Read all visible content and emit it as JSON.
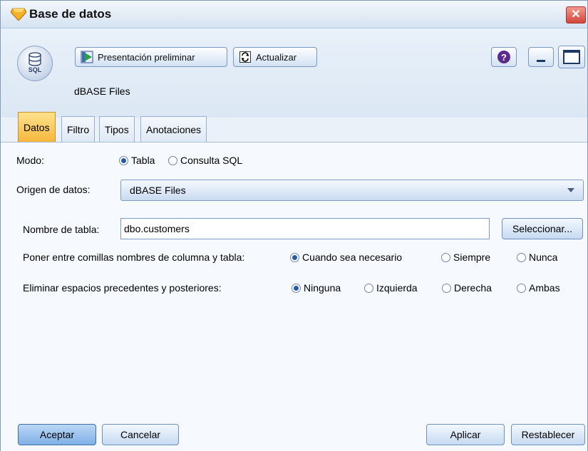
{
  "window": {
    "title": "Base de datos",
    "close_glyph": "✕"
  },
  "toolbar": {
    "preview_label": "Presentación preliminar",
    "refresh_label": "Actualizar",
    "help_glyph": "?"
  },
  "node": {
    "icon_label": "SQL",
    "name": "dBASE Files"
  },
  "tabs": [
    {
      "label": "Datos",
      "active": true
    },
    {
      "label": "Filtro",
      "active": false
    },
    {
      "label": "Tipos",
      "active": false
    },
    {
      "label": "Anotaciones",
      "active": false
    }
  ],
  "form": {
    "mode_label": "Modo:",
    "mode_options": [
      "Tabla",
      "Consulta SQL"
    ],
    "mode_selected": "Tabla",
    "source_label": "Origen de datos:",
    "source_value": "dBASE Files",
    "table_label": "Nombre de tabla:",
    "table_value": "dbo.customers",
    "select_button": "Seleccionar...",
    "quote_label": "Poner entre comillas nombres de columna y tabla:",
    "quote_options": [
      "Cuando sea necesario",
      "Siempre",
      "Nunca"
    ],
    "quote_selected": "Cuando sea necesario",
    "trim_label": "Eliminar espacios precedentes y posteriores:",
    "trim_options": [
      "Ninguna",
      "Izquierda",
      "Derecha",
      "Ambas"
    ],
    "trim_selected": "Ninguna"
  },
  "footer": {
    "ok": "Aceptar",
    "cancel": "Cancelar",
    "apply": "Aplicar",
    "reset": "Restablecer"
  },
  "colors": {
    "active_tab": "#f6b73c",
    "accent": "#2659a8",
    "close": "#d0463a"
  }
}
